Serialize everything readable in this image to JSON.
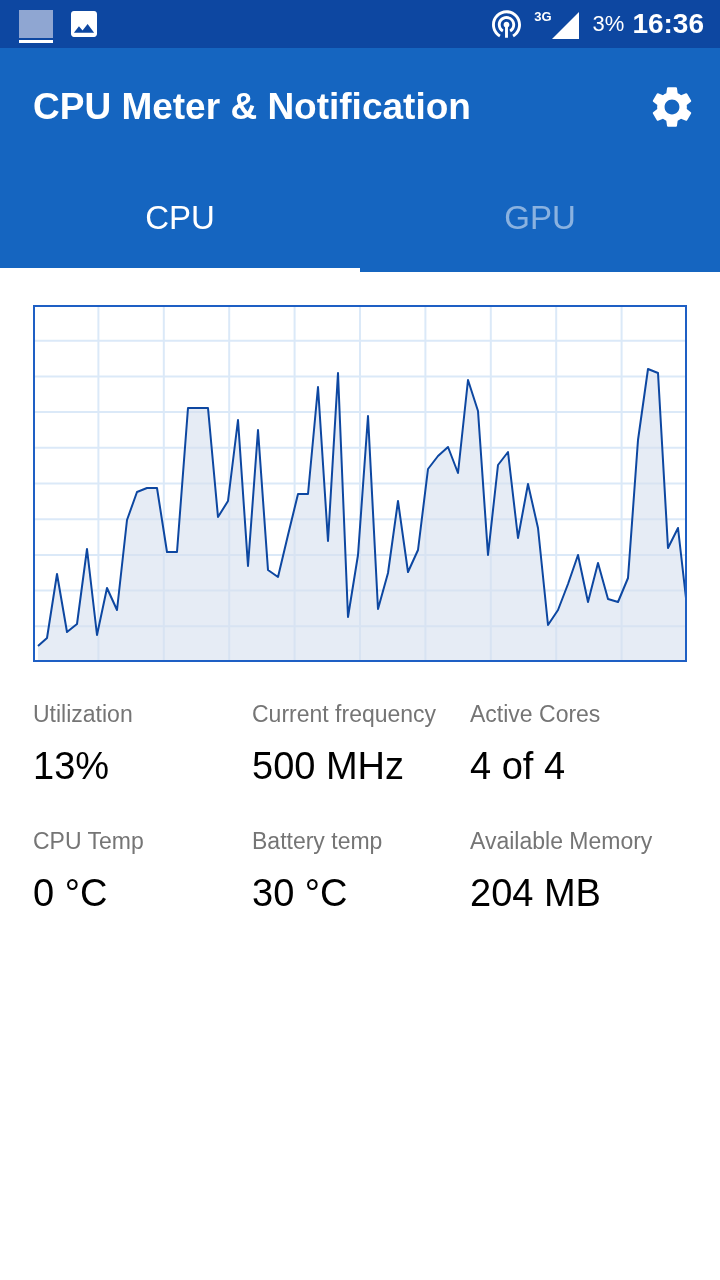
{
  "status_bar": {
    "network_type": "3G",
    "battery": "3%",
    "time": "16:36"
  },
  "app_bar": {
    "title": "CPU Meter & Notification"
  },
  "tabs": [
    {
      "label": "CPU",
      "selected": true
    },
    {
      "label": "GPU",
      "selected": false
    }
  ],
  "stats": [
    {
      "label": "Utilization",
      "value": "13%"
    },
    {
      "label": "Current frequency",
      "value": "500 MHz"
    },
    {
      "label": "Active Cores",
      "value": "4 of 4"
    },
    {
      "label": "CPU Temp",
      "value": "0 °C"
    },
    {
      "label": "Battery temp",
      "value": "30 °C"
    },
    {
      "label": "Available Memory",
      "value": "204 MB"
    }
  ]
}
